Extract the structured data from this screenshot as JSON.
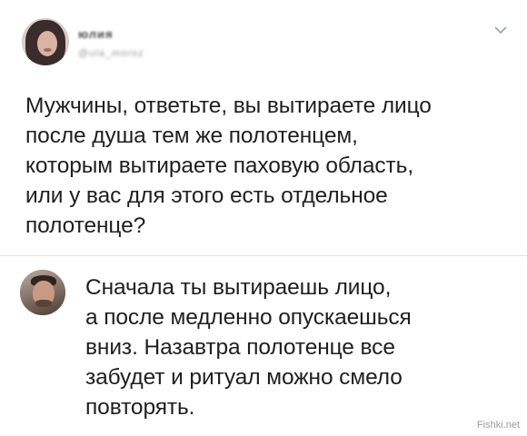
{
  "tweet": {
    "user_name": "юлия",
    "user_handle": "@ula_moroz",
    "text": "Мужчины, ответьте, вы вытираете лицо\nпосле душа тем же полотенцем,\nкоторым вытираете паховую область,\nили у вас для этого есть отдельное\nполотенце?"
  },
  "reply": {
    "text": "Сначала ты вытираешь лицо,\nа после медленно опускаешься\nвниз. Назавтра полотенце все\nзабудет и ритуал можно смело\nповторять."
  },
  "icons": {
    "menu": "chevron-down-icon"
  },
  "watermark": "Fishki.net",
  "colors": {
    "background": "#ffffff",
    "text": "#1f1f1f",
    "divider": "#e4e4e4",
    "secondary": "#9a9a9a"
  }
}
